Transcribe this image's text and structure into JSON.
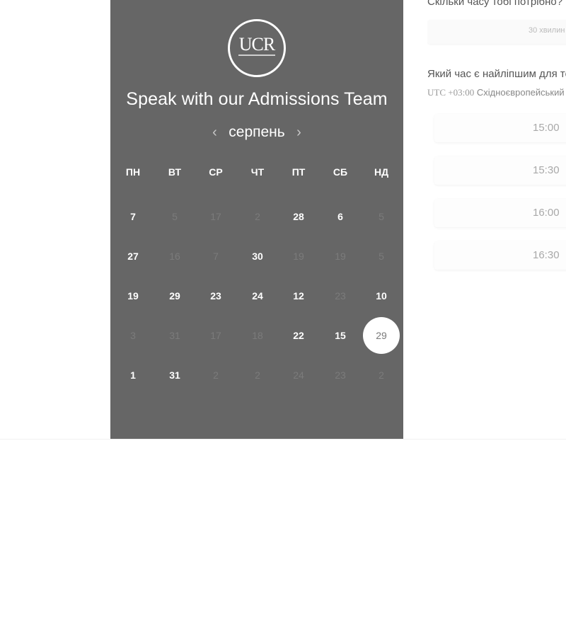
{
  "calendar": {
    "logo_text": "UCR",
    "title": "Speak with our Admissions Team",
    "month": "серпень",
    "prev_icon": "‹",
    "next_icon": "›",
    "weekdays": [
      "ПН",
      "ВТ",
      "СР",
      "ЧТ",
      "ПТ",
      "СБ",
      "НД"
    ],
    "weeks": [
      [
        {
          "d": "7",
          "a": true
        },
        {
          "d": "5",
          "a": false
        },
        {
          "d": "17",
          "a": false
        },
        {
          "d": "2",
          "a": false
        },
        {
          "d": "28",
          "a": true
        },
        {
          "d": "6",
          "a": true
        },
        {
          "d": "5",
          "a": false
        }
      ],
      [
        {
          "d": "27",
          "a": true
        },
        {
          "d": "16",
          "a": false
        },
        {
          "d": "7",
          "a": false
        },
        {
          "d": "30",
          "a": true
        },
        {
          "d": "19",
          "a": false
        },
        {
          "d": "19",
          "a": false
        },
        {
          "d": "5",
          "a": false
        }
      ],
      [
        {
          "d": "19",
          "a": true
        },
        {
          "d": "29",
          "a": true
        },
        {
          "d": "23",
          "a": true
        },
        {
          "d": "24",
          "a": true
        },
        {
          "d": "12",
          "a": true
        },
        {
          "d": "23",
          "a": false
        },
        {
          "d": "10",
          "a": true
        }
      ],
      [
        {
          "d": "3",
          "a": false
        },
        {
          "d": "31",
          "a": false
        },
        {
          "d": "17",
          "a": false
        },
        {
          "d": "18",
          "a": false
        },
        {
          "d": "22",
          "a": true
        },
        {
          "d": "15",
          "a": true
        },
        {
          "d": "29",
          "a": true,
          "selected": true
        }
      ],
      [
        {
          "d": "1",
          "a": true
        },
        {
          "d": "31",
          "a": true
        },
        {
          "d": "2",
          "a": false
        },
        {
          "d": "2",
          "a": false
        },
        {
          "d": "24",
          "a": false
        },
        {
          "d": "23",
          "a": false
        },
        {
          "d": "2",
          "a": false
        }
      ]
    ]
  },
  "booking": {
    "duration_question": "Скільки часу тобі потрібно?",
    "duration_value": "30 хвилин",
    "time_question": "Який час є найліпшим для тебе?",
    "tz_offset": "UTC +03:00",
    "tz_name": "Східноєвропейський час",
    "slots": [
      "15:00",
      "15:30",
      "16:00",
      "16:30"
    ]
  },
  "colors": {
    "panel": "#666666",
    "text_on_panel": "#ffffff",
    "inactive_day": "#7b7b7b"
  }
}
